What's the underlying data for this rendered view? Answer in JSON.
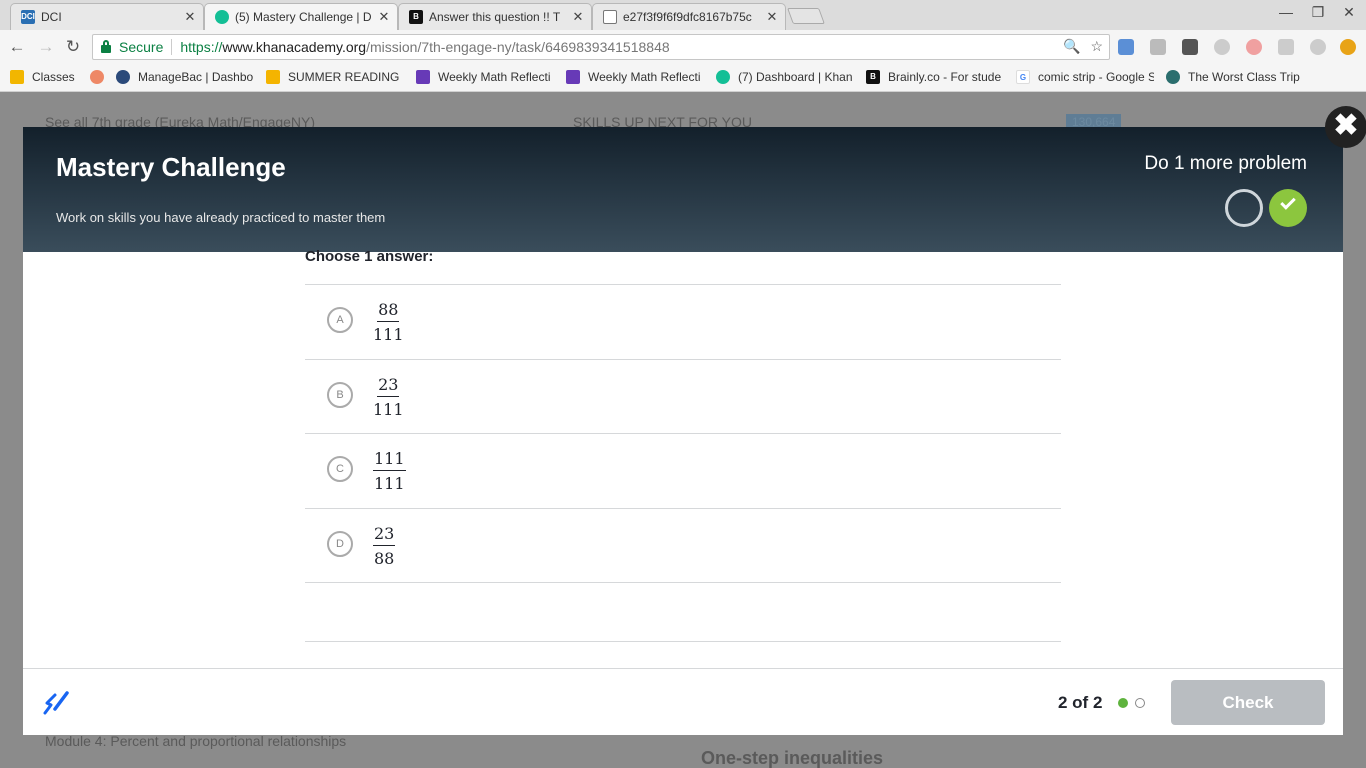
{
  "browser": {
    "tabs": [
      {
        "title": "DCI"
      },
      {
        "title": "(5) Mastery Challenge | D"
      },
      {
        "title": "Answer this question !! T"
      },
      {
        "title": "e27f3f9f6f9dfc8167b75c"
      }
    ],
    "address": {
      "secure_label": "Secure",
      "scheme": "https://",
      "host": "www.khanacademy.org",
      "path": "/mission/7th-engage-ny/task/6469839341518848"
    },
    "bookmarks": [
      "Classes",
      "ManageBac | Dashbo",
      "SUMMER READING -",
      "Weekly Math Reflecti",
      "Weekly Math Reflecti",
      "(7) Dashboard | Khan",
      "Brainly.co - For stude",
      "comic strip - Google S",
      "The Worst Class Trip"
    ]
  },
  "background": {
    "back_link": "See all 7th grade (Eureka Math/EngageNY)",
    "skills_up_next": "SKILLS UP NEXT FOR YOU",
    "points": "130,664",
    "module": "Module 4: Percent and proportional relationships",
    "next_skill": "One-step inequalities"
  },
  "modal": {
    "title": "Mastery Challenge",
    "subtitle": "Work on skills you have already practiced to master them",
    "do_more": "Do 1 more problem",
    "close": "✖"
  },
  "question": {
    "prompt": "Choose 1 answer:",
    "choices": [
      {
        "letter": "A",
        "numerator": "88",
        "denominator": "111"
      },
      {
        "letter": "B",
        "numerator": "23",
        "denominator": "111"
      },
      {
        "letter": "C",
        "numerator": "111",
        "denominator": "111"
      },
      {
        "letter": "D",
        "numerator": "23",
        "denominator": "88"
      }
    ]
  },
  "footer": {
    "progress_text": "2 of 2",
    "check_label": "Check"
  },
  "colors": {
    "accent_green": "#8cc63e",
    "header_dark": "#13202b",
    "check_disabled": "#b9bdc1"
  }
}
